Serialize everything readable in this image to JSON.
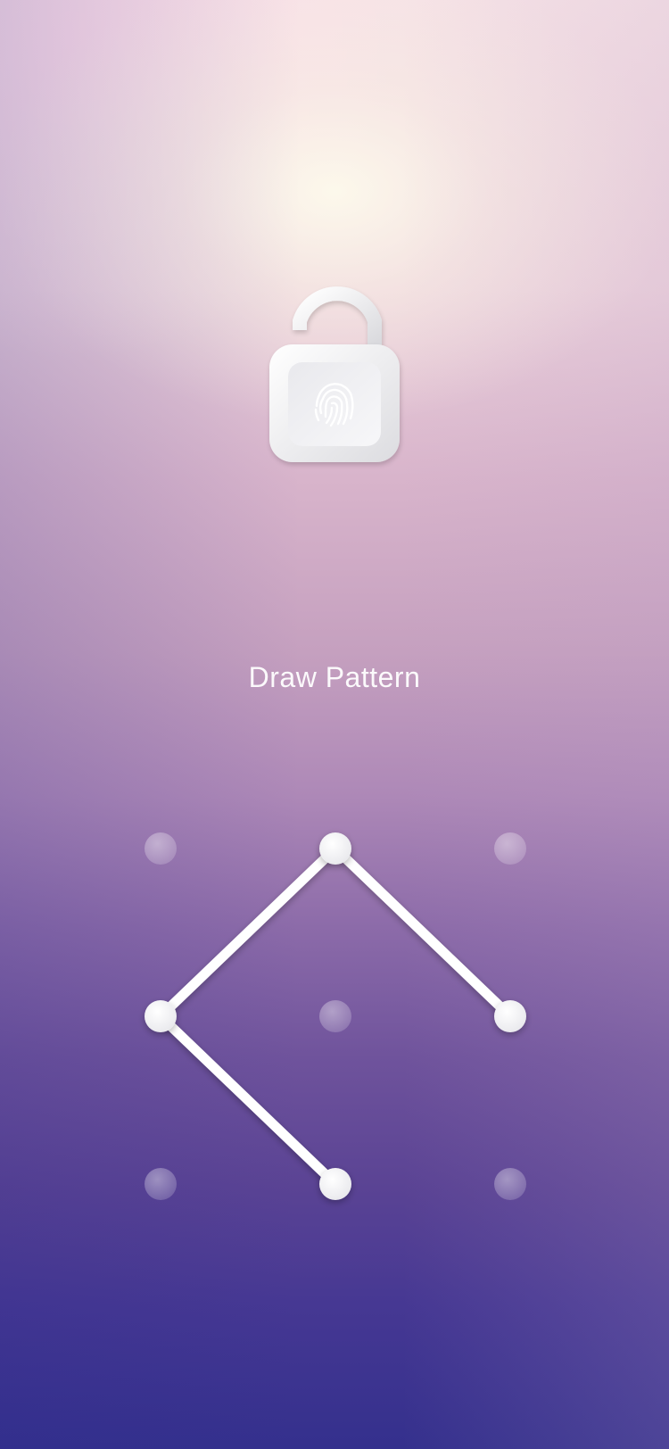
{
  "screen": {
    "title": "Draw Pattern"
  },
  "icons": {
    "lock": "unlocked-padlock-icon",
    "fingerprint": "fingerprint-icon"
  },
  "pattern": {
    "grid": [
      3,
      3
    ],
    "selected_path": [
      {
        "row": 0,
        "col": 1
      },
      {
        "row": 0,
        "col": 2
      }
    ],
    "lines": [
      {
        "from": {
          "row": 0,
          "col": 1
        },
        "to": {
          "row": 1,
          "col": 0
        }
      },
      {
        "from": {
          "row": 1,
          "col": 0
        },
        "to": {
          "row": 2,
          "col": 1
        }
      },
      {
        "from": {
          "row": 0,
          "col": 1
        },
        "to": {
          "row": 1,
          "col": 2
        }
      }
    ],
    "selected": [
      {
        "row": 0,
        "col": 1
      },
      {
        "row": 1,
        "col": 0
      },
      {
        "row": 2,
        "col": 1
      },
      {
        "row": 1,
        "col": 2
      }
    ]
  },
  "colors": {
    "line": "#ffffff",
    "dot_active": "#f2f2f4",
    "dot_inactive": "#ffffff"
  }
}
